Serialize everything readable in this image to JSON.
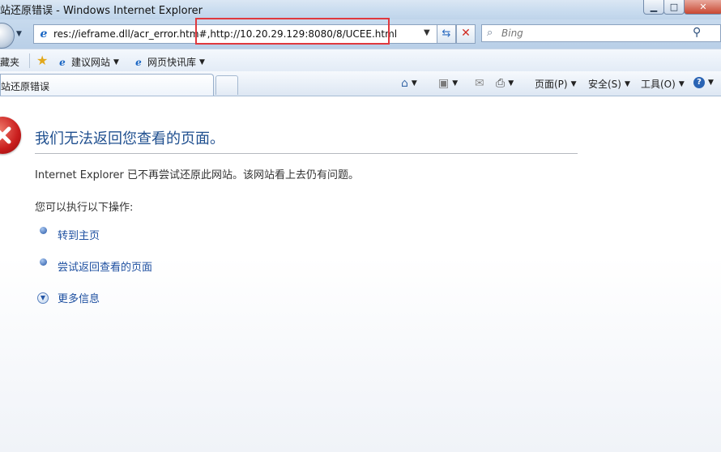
{
  "window": {
    "title": "站还原错误 - Windows Internet Explorer"
  },
  "address": {
    "url": "res://ieframe.dll/acr_error.htm#,http://10.20.29.129:8080/8/UCEE.html"
  },
  "search": {
    "placeholder": "Bing"
  },
  "favorites": {
    "label": "藏夹",
    "items": [
      {
        "label": "建议网站"
      },
      {
        "label": "网页快讯库"
      }
    ]
  },
  "tab": {
    "title": "站还原错误"
  },
  "commands": {
    "page": "页面(P)",
    "safety": "安全(S)",
    "tools": "工具(O)"
  },
  "error_page": {
    "heading": "我们无法返回您查看的页面。",
    "description": "Internet Explorer 已不再尝试还原此网站。该网站看上去仍有问题。",
    "prompt": "您可以执行以下操作:",
    "actions": [
      {
        "label": "转到主页"
      },
      {
        "label": "尝试返回查看的页面"
      }
    ],
    "more_info": "更多信息"
  },
  "colors": {
    "highlight_box": "#e0393e",
    "heading": "#1f4f8f",
    "link": "#1d4fa0"
  }
}
